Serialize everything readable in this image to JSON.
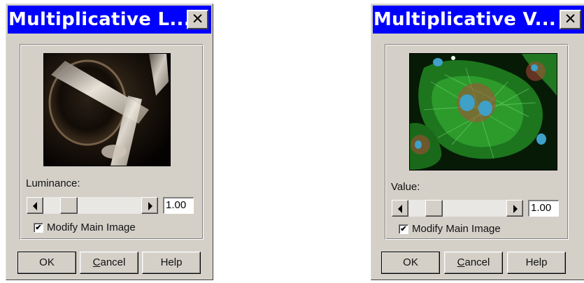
{
  "dialogs": [
    {
      "title": "Multiplicative L...",
      "close_label": "✕",
      "slider_label": "Luminance:",
      "slider_value": 1.0,
      "value_text": "1.00",
      "checkbox_label": "Modify Main Image",
      "checkbox_checked": true,
      "preview_icon": "metal-tips-photo",
      "buttons": {
        "ok": "OK",
        "cancel_first": "C",
        "cancel_rest": "ancel",
        "help": "Help"
      }
    },
    {
      "title": "Multiplicative V...",
      "close_label": "✕",
      "slider_label": "Value:",
      "slider_value": 1.0,
      "value_text": "1.00",
      "checkbox_label": "Modify Main Image",
      "checkbox_checked": true,
      "preview_icon": "fluorescent-cells-photo",
      "buttons": {
        "ok": "OK",
        "cancel_first": "C",
        "cancel_rest": "ancel",
        "help": "Help"
      }
    }
  ],
  "colors": {
    "titlebar": "#0000ff",
    "dialog_face": "#d4d0c8"
  }
}
